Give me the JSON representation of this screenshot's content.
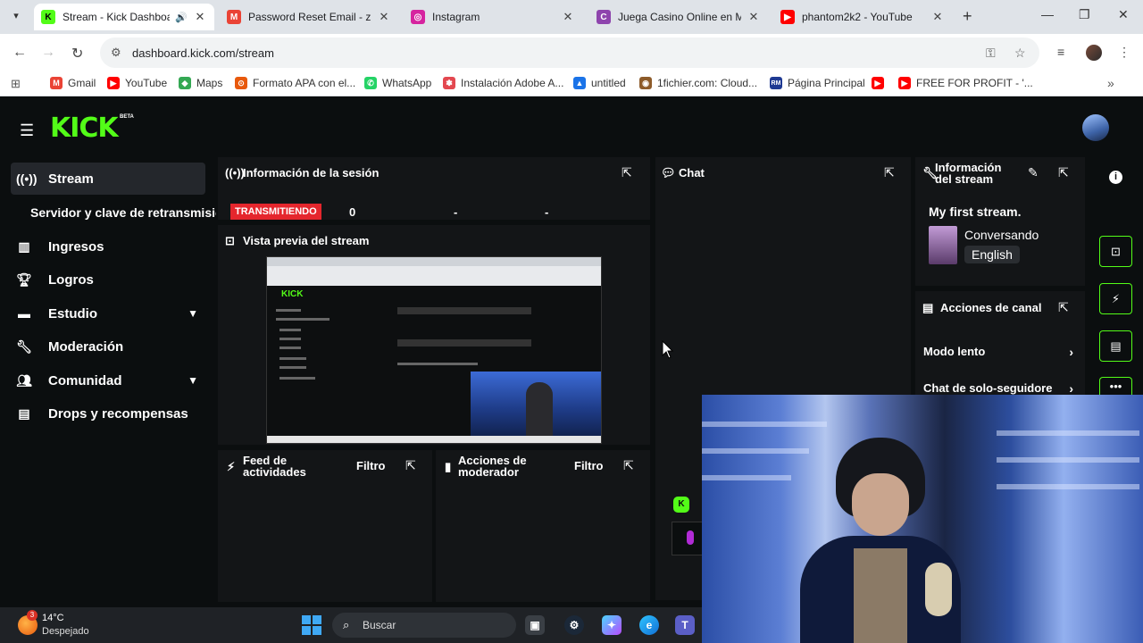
{
  "browser": {
    "tabs": [
      {
        "title": "Stream - Kick Dashboard",
        "fav_text": "K",
        "fav_color": "#53fc18",
        "active": true
      },
      {
        "title": "Password Reset Email - zuka",
        "fav_text": "M",
        "fav_color": "#ea4335"
      },
      {
        "title": "Instagram",
        "fav_text": "◎",
        "fav_color": "#d6249f"
      },
      {
        "title": "Juega Casino Online en Méx",
        "fav_text": "C",
        "fav_color": "#8e44ad"
      },
      {
        "title": "phantom2k2 - YouTube",
        "fav_text": "▶",
        "fav_color": "#ff0000"
      }
    ],
    "url": "dashboard.kick.com/stream",
    "bookmarks": [
      {
        "label": "Gmail",
        "icon_text": "M",
        "color": "#ea4335"
      },
      {
        "label": "YouTube",
        "icon_text": "▶",
        "color": "#ff0000"
      },
      {
        "label": "Maps",
        "icon_text": "◆",
        "color": "#34a853"
      },
      {
        "label": "Formato APA con el...",
        "icon_text": "⊙",
        "color": "#e8590c"
      },
      {
        "label": "WhatsApp",
        "icon_text": "✆",
        "color": "#25d366"
      },
      {
        "label": "Instalación Adobe A...",
        "icon_text": "✽",
        "color": "#e34850"
      },
      {
        "label": "untitled",
        "icon_text": "▲",
        "color": "#1a73e8"
      },
      {
        "label": "1fichier.com: Cloud...",
        "icon_text": "◉",
        "color": "#8d5b2a"
      },
      {
        "label": "Página Principal",
        "icon_text": "RM",
        "color": "#1f3a93"
      },
      {
        "label": "",
        "icon_text": "▶",
        "color": "#ff0000"
      },
      {
        "label": "FREE FOR PROFIT - '...",
        "icon_text": "▶",
        "color": "#ff0000"
      }
    ]
  },
  "app": {
    "logo": "KICK",
    "logo_badge": "BETA",
    "brand_color": "#53fc18",
    "nav": [
      {
        "label": "Stream",
        "icon": "broadcast-icon"
      },
      {
        "label": "Ingresos",
        "icon": "chart-icon"
      },
      {
        "label": "Logros",
        "icon": "trophy-icon"
      },
      {
        "label": "Estudio",
        "icon": "studio-icon"
      },
      {
        "label": "Moderación",
        "icon": "wrench-icon"
      },
      {
        "label": "Comunidad",
        "icon": "community-icon"
      },
      {
        "label": "Drops y recompensas",
        "icon": "drops-icon"
      }
    ],
    "nav_sub": "Servidor y clave de retransmisión",
    "session": {
      "title": "Información de la sesión",
      "status": "TRANSMITIENDO",
      "viewers": "0",
      "stat2": "-",
      "stat3": "-"
    },
    "preview": {
      "title": "Vista previa del stream",
      "mini_logo": "KICK"
    },
    "chat": {
      "title": "Chat"
    },
    "stream_info": {
      "title_line1": "Información",
      "title_line2": "del stream",
      "stream_title": "My first stream.",
      "category": "Conversando",
      "language": "English"
    },
    "channel_actions": {
      "title": "Acciones de canal",
      "items": [
        "Modo lento",
        "Chat de solo-seguidore"
      ]
    },
    "feed": {
      "title_line1": "Feed de",
      "title_line2": "actividades",
      "filter": "Filtro"
    },
    "mod_actions": {
      "title_line1": "Acciones de",
      "title_line2": "moderador",
      "filter": "Filtro"
    }
  },
  "taskbar": {
    "weather_badge": "3",
    "temp": "14°C",
    "condition": "Despejado",
    "search_placeholder": "Buscar"
  }
}
